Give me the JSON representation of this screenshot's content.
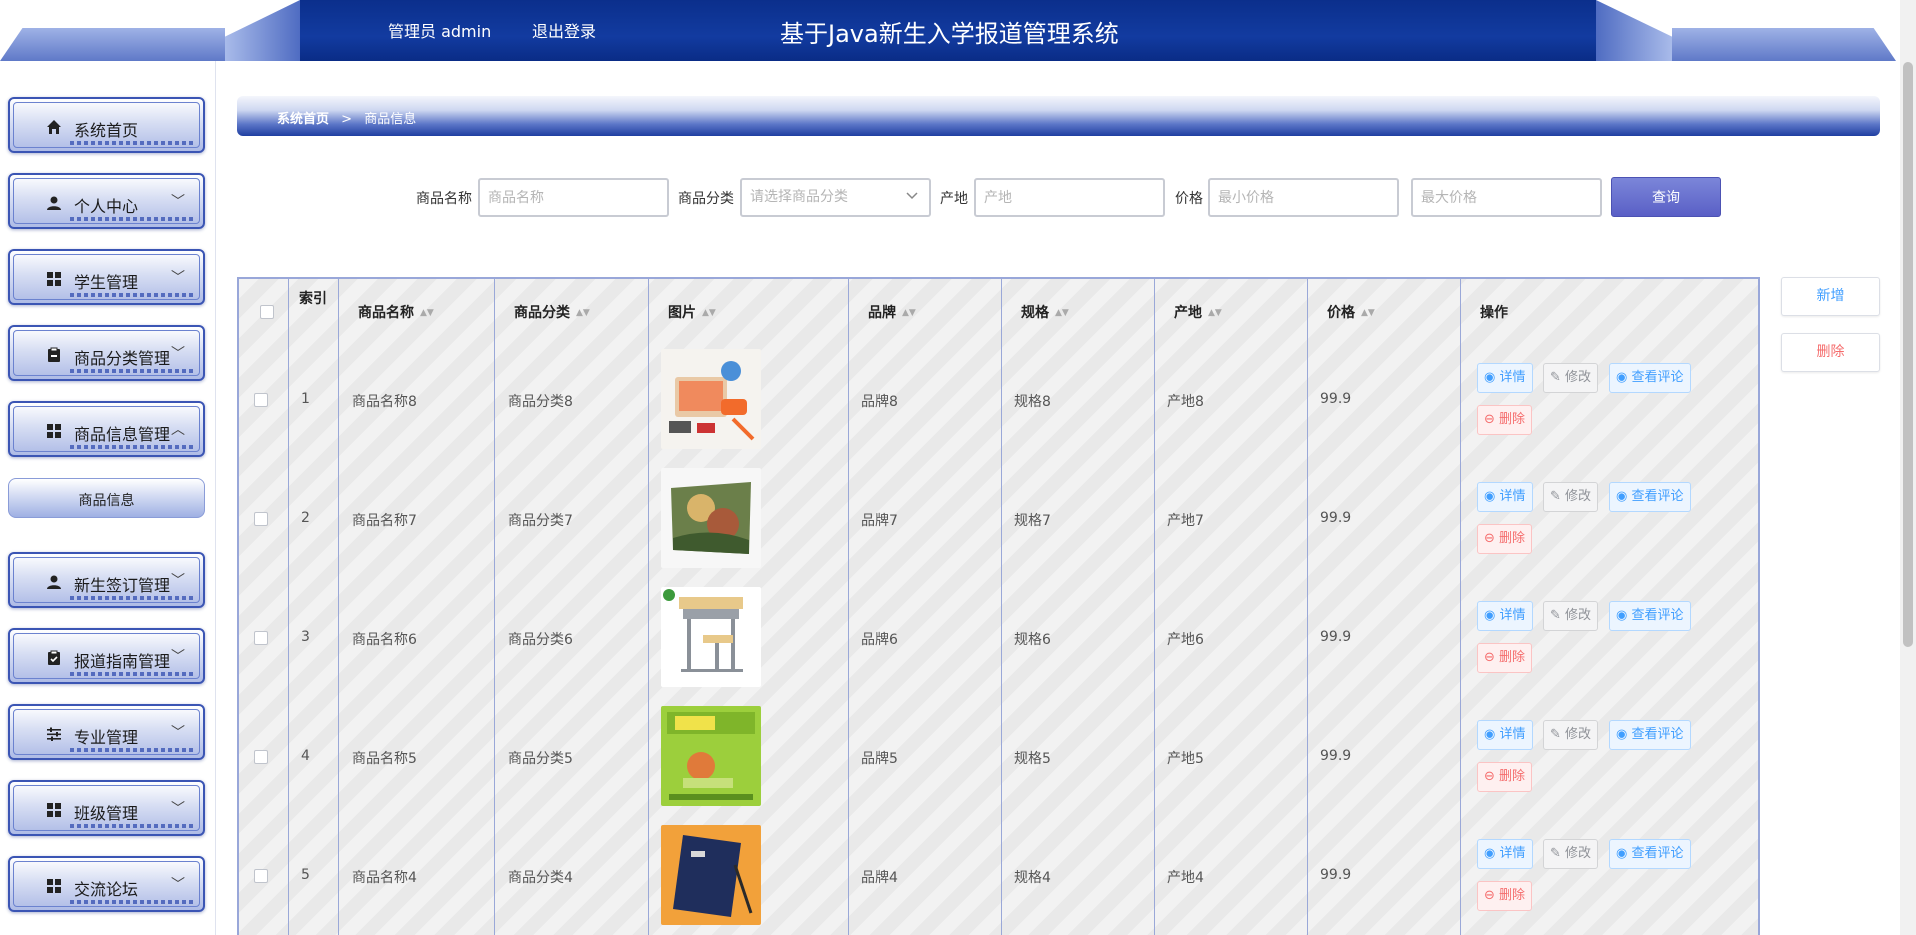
{
  "header": {
    "user_text": "管理员 admin",
    "logout_label": "退出登录",
    "title": "基于Java新生入学报道管理系统"
  },
  "sidebar": {
    "items": [
      {
        "label": "系统首页",
        "icon": "home-icon",
        "expandable": false
      },
      {
        "label": "个人中心",
        "icon": "user-icon",
        "expandable": true
      },
      {
        "label": "学生管理",
        "icon": "grid-icon",
        "expandable": true
      },
      {
        "label": "商品分类管理",
        "icon": "clipboard-icon",
        "expandable": true
      },
      {
        "label": "商品信息管理",
        "icon": "grid-icon",
        "expandable": true,
        "expanded": true
      },
      {
        "label": "新生签订管理",
        "icon": "user-icon",
        "expandable": true
      },
      {
        "label": "报道指南管理",
        "icon": "clipboard-check-icon",
        "expandable": true
      },
      {
        "label": "专业管理",
        "icon": "sliders-icon",
        "expandable": true
      },
      {
        "label": "班级管理",
        "icon": "grid-icon",
        "expandable": true
      },
      {
        "label": "交流论坛",
        "icon": "grid-icon",
        "expandable": true
      }
    ],
    "submenu_label": "商品信息",
    "chevron_down": "﹀",
    "chevron_up": "︿"
  },
  "breadcrumb": {
    "home": "系统首页",
    "separator": ">",
    "current": "商品信息"
  },
  "search": {
    "name_label": "商品名称",
    "name_placeholder": "商品名称",
    "category_label": "商品分类",
    "category_placeholder": "请选择商品分类",
    "origin_label": "产地",
    "origin_placeholder": "产地",
    "price_label": "价格",
    "min_price_placeholder": "最小价格",
    "max_price_placeholder": "最大价格",
    "query_label": "查询"
  },
  "actions": {
    "add_label": "新增",
    "delete_label": "删除"
  },
  "table": {
    "headers": {
      "index": "索引",
      "name": "商品名称",
      "category": "商品分类",
      "image": "图片",
      "brand": "品牌",
      "spec": "规格",
      "origin": "产地",
      "price": "价格",
      "ops": "操作"
    },
    "sort_icon": "▲▼",
    "op_labels": {
      "detail": "详情",
      "edit": "修改",
      "review": "查看评论",
      "delete": "删除"
    },
    "rows": [
      {
        "index": "1",
        "name": "商品名称8",
        "category": "商品分类8",
        "image": "toy-set-photo",
        "brand": "品牌8",
        "spec": "规格8",
        "origin": "产地8",
        "price": "99.9"
      },
      {
        "index": "2",
        "name": "商品名称7",
        "category": "商品分类7",
        "image": "picture-book-photo",
        "brand": "品牌7",
        "spec": "规格7",
        "origin": "产地7",
        "price": "99.9"
      },
      {
        "index": "3",
        "name": "商品名称6",
        "category": "商品分类6",
        "image": "school-desk-photo",
        "brand": "品牌6",
        "spec": "规格6",
        "origin": "产地6",
        "price": "99.9"
      },
      {
        "index": "4",
        "name": "商品名称5",
        "category": "商品分类5",
        "image": "campus-book-photo",
        "brand": "品牌5",
        "spec": "规格5",
        "origin": "产地5",
        "price": "99.9"
      },
      {
        "index": "5",
        "name": "商品名称4",
        "category": "商品分类4",
        "image": "notebook-photo",
        "brand": "品牌4",
        "spec": "规格4",
        "origin": "产地4",
        "price": "99.9"
      }
    ]
  },
  "colors": {
    "header_blue": "#123ba0",
    "accent": "#409eff",
    "danger": "#f56c6c",
    "query_btn": "#5a5fc6"
  }
}
